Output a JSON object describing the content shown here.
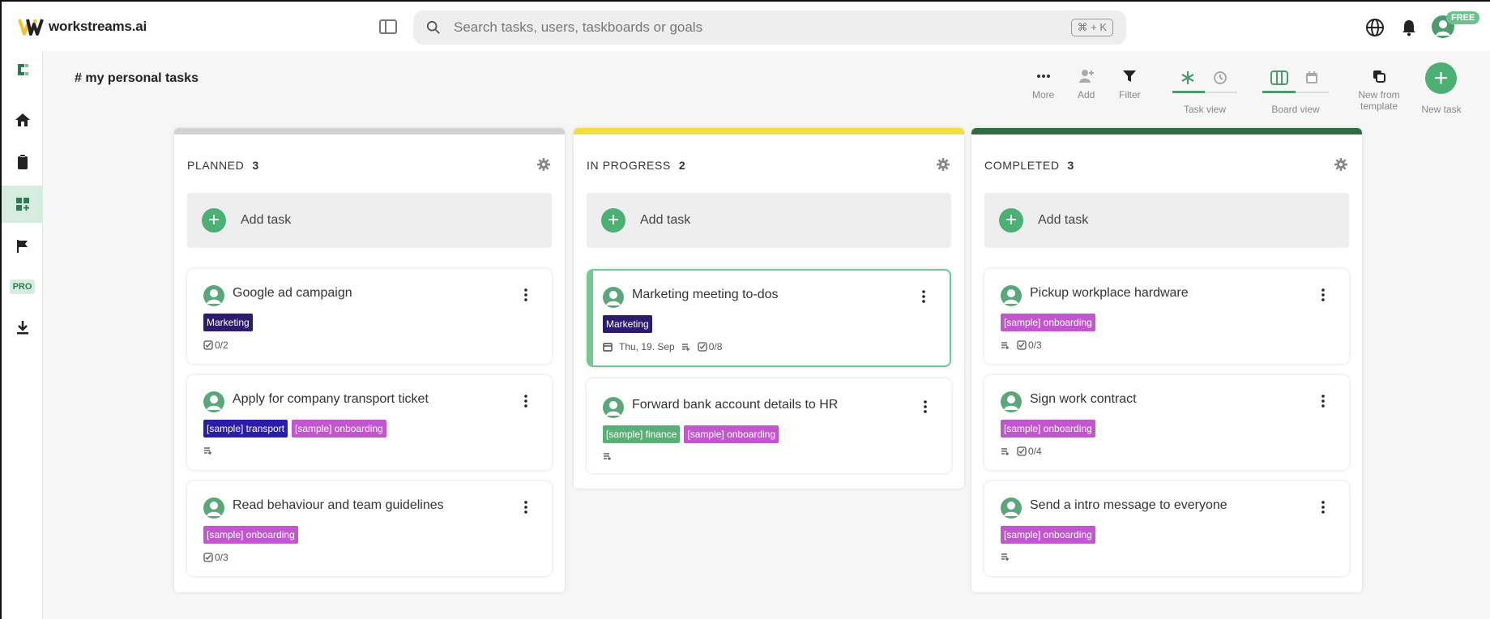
{
  "app": {
    "name": "workstreams.ai",
    "search_placeholder": "Search tasks, users, taskboards or goals",
    "search_shortcut": "⌘ + K",
    "plan_badge": "FREE",
    "nav_pro_badge": "PRO",
    "accent": "#4caf73"
  },
  "page": {
    "title": "# my personal tasks"
  },
  "toolbar": {
    "more": "More",
    "add": "Add",
    "filter": "Filter",
    "task_view": "Task view",
    "board_view": "Board view",
    "new_from_template": "New from template",
    "new_task": "New task"
  },
  "columns": [
    {
      "title": "PLANNED",
      "count": "3",
      "color": "#d2d2d2",
      "add_label": "Add task",
      "cards": [
        {
          "title": "Google ad campaign",
          "tags": [
            {
              "label": "Marketing",
              "color": "#2d1b6e"
            }
          ],
          "checklist": "0/2"
        },
        {
          "title": "Apply for company transport ticket",
          "tags": [
            {
              "label": "[sample] transport",
              "color": "#2a1ea8"
            },
            {
              "label": "[sample] onboarding",
              "color": "#c256cf"
            }
          ],
          "checklist": ""
        },
        {
          "title": "Read behaviour and team guidelines",
          "tags": [
            {
              "label": "[sample] onboarding",
              "color": "#c256cf"
            }
          ],
          "checklist": "0/3"
        }
      ]
    },
    {
      "title": "IN PROGRESS",
      "count": "2",
      "color": "#f2dd3a",
      "add_label": "Add task",
      "cards": [
        {
          "title": "Marketing meeting to-dos",
          "tags": [
            {
              "label": "Marketing",
              "color": "#2d1b6e"
            }
          ],
          "date": "Thu, 19. Sep",
          "checklist": "0/8"
        },
        {
          "title": "Forward bank account details to HR",
          "tags": [
            {
              "label": "[sample] finance",
              "color": "#5aaf76"
            },
            {
              "label": "[sample] onboarding",
              "color": "#c256cf"
            }
          ],
          "checklist": ""
        }
      ]
    },
    {
      "title": "COMPLETED",
      "count": "3",
      "color": "#2f6d45",
      "add_label": "Add task",
      "cards": [
        {
          "title": "Pickup workplace hardware",
          "tags": [
            {
              "label": "[sample] onboarding",
              "color": "#c256cf"
            }
          ],
          "checklist": "0/3"
        },
        {
          "title": "Sign work contract",
          "tags": [
            {
              "label": "[sample] onboarding",
              "color": "#c256cf"
            }
          ],
          "checklist": "0/4"
        },
        {
          "title": "Send a intro message to everyone",
          "tags": [
            {
              "label": "[sample] onboarding",
              "color": "#c256cf"
            }
          ],
          "checklist": ""
        }
      ]
    }
  ]
}
